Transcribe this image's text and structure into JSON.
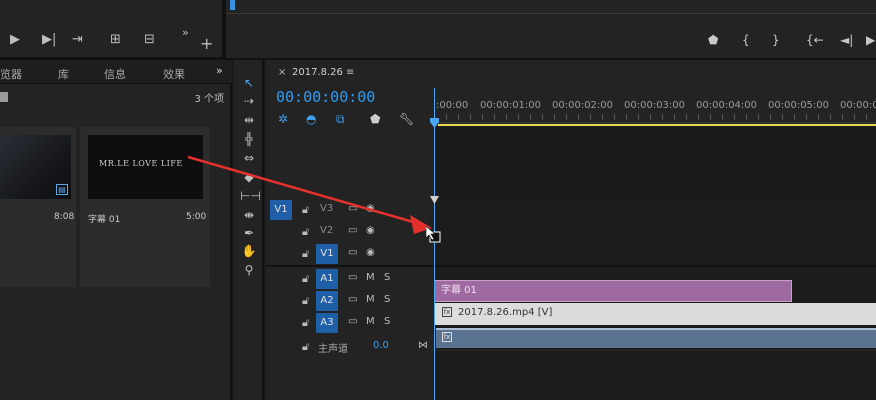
{
  "source_controls": {
    "play_icon": "play-icon",
    "step_icon": "step-forward-icon",
    "insert_icon": "insert-icon",
    "overwrite_icon": "overwrite-icon",
    "export_icon": "export-frame-icon",
    "more": "»",
    "add": "+"
  },
  "program_controls": {
    "marker": "marker-icon",
    "in_brace": "{",
    "out_brace": "}",
    "goto_in": "{←",
    "step_back": "◄|"
  },
  "project_panel": {
    "tabs": [
      "览器",
      "库",
      "信息",
      "效果"
    ],
    "more": "»",
    "count": "3 个项",
    "items": [
      {
        "duration": "8:08"
      },
      {
        "name": "字幕 01",
        "preview_text": "MR.LE LOVE LIFE",
        "duration": "5:00"
      }
    ]
  },
  "timeline": {
    "sequence_name": "2017.8.26",
    "timecode": "00:00:00:00",
    "ruler_ticks": [
      ":00:00",
      "00:00:01:00",
      "00:00:02:00",
      "00:00:03:00",
      "00:00:04:00",
      "00:00:05:00",
      "00:00:06"
    ],
    "tracks": {
      "v3": {
        "target": "V1",
        "name": "V3"
      },
      "v2": {
        "name": "V2"
      },
      "v1": {
        "target": "V1"
      },
      "a1": {
        "target": "A1",
        "m": "M",
        "s": "S"
      },
      "a2": {
        "target": "A2",
        "m": "M",
        "s": "S"
      },
      "a3": {
        "target": "A3",
        "m": "M",
        "s": "S"
      },
      "master": {
        "name": "主声道",
        "value": "0.0"
      }
    },
    "clips": {
      "title_clip": "字幕 01",
      "video_clip": "2017.8.26.mp4 [V]"
    }
  },
  "colors": {
    "accent": "#2e9bf0",
    "title_clip": "#9f6aa2",
    "audio_clip": "#5a7390",
    "arrow": "#e5312c"
  }
}
